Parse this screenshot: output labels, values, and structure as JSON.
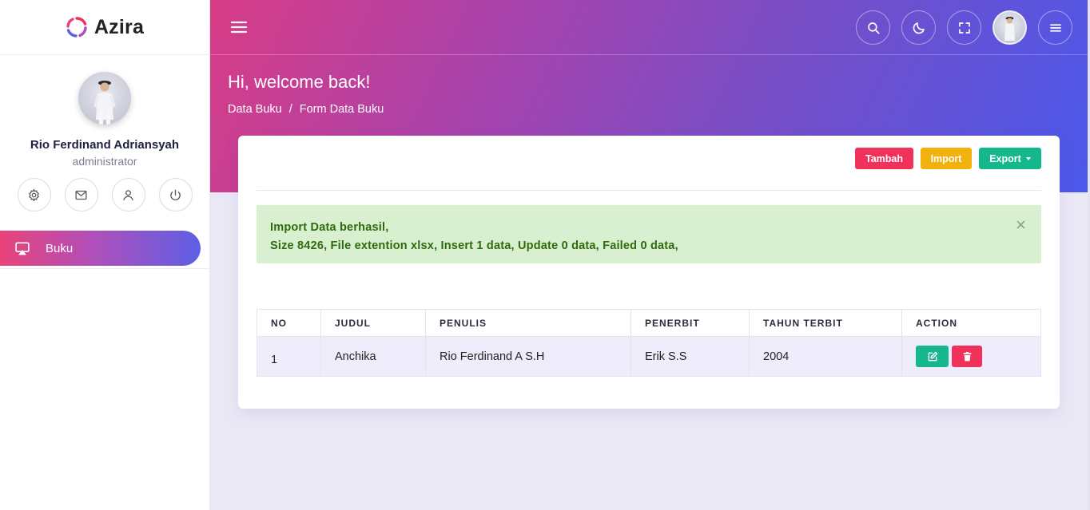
{
  "brand": {
    "name": "Azira"
  },
  "profile": {
    "name": "Rio Ferdinand Adriansyah",
    "role": "administrator"
  },
  "profile_actions": [
    "gear-icon",
    "mail-icon",
    "user-icon",
    "power-icon"
  ],
  "nav": {
    "items": [
      {
        "label": "Buku",
        "icon": "screen-icon",
        "active": true
      }
    ]
  },
  "header": {
    "welcome": "Hi, welcome back!",
    "breadcrumb": [
      "Data Buku",
      "/",
      "Form Data Buku"
    ],
    "icons": [
      "search-icon",
      "moon-icon",
      "fullscreen-icon",
      "avatar",
      "menu-icon"
    ]
  },
  "card": {
    "buttons": {
      "add": "Tambah",
      "import": "Import",
      "export": "Export"
    },
    "alert": {
      "line1": "Import Data berhasil,",
      "line2": "Size 8426, File extention xlsx, Insert 1 data, Update 0 data, Failed 0 data,",
      "close": "×"
    },
    "table": {
      "headers": [
        "NO",
        "JUDUL",
        "PENULIS",
        "PENERBIT",
        "TAHUN TERBIT",
        "ACTION"
      ],
      "rows": [
        {
          "no": "1",
          "judul": "Anchika",
          "penulis": "Rio Ferdinand A S.H",
          "penerbit": "Erik S.S",
          "tahun": "2004"
        }
      ]
    }
  },
  "colors": {
    "accent_pink": "#e9437a",
    "accent_blue": "#4a58eb",
    "danger": "#f0325b",
    "warning": "#f1b20e",
    "success": "#17b78e",
    "alert_bg": "#d8efd0"
  }
}
